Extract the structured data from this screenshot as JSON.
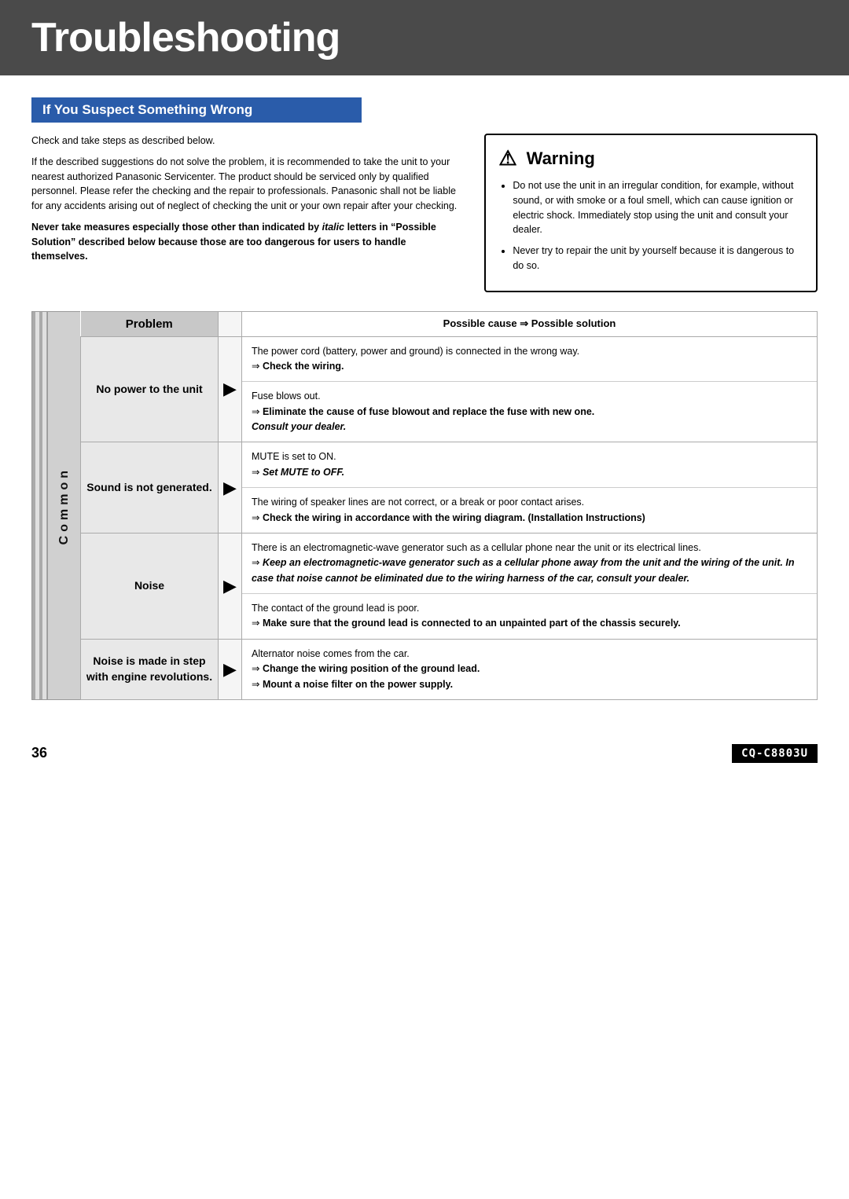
{
  "page": {
    "title": "Troubleshooting",
    "page_number": "36",
    "model": "CQ-C8803U"
  },
  "section": {
    "heading": "If You Suspect Something Wrong",
    "intro_p1": "Check and take steps as described below.",
    "intro_p2": "If the described suggestions do not solve the problem, it is recommended to take the unit to your nearest authorized Panasonic Servicenter. The product should be serviced only by qualified personnel. Please refer the checking and the repair to professionals. Panasonic shall not be liable for any accidents arising out of neglect of checking the unit or your own repair after your checking.",
    "intro_bold": "Never take measures especially those other than indicated by italic letters in “Possible Solution” described below because those are too dangerous for users to handle themselves."
  },
  "warning": {
    "title": "Warning",
    "bullet1": "Do not use the unit in an irregular condition, for example, without sound, or with smoke or a foul smell, which can cause ignition or electric shock. Immediately stop using the unit and consult your dealer.",
    "bullet2": "Never try to repair the unit by yourself because it is dangerous to do so."
  },
  "table": {
    "header_problem": "Problem",
    "header_solution": "Possible cause ⇒ Possible solution",
    "common_label": "Common",
    "rows": [
      {
        "problem": "No power to the unit",
        "solutions": [
          {
            "cause": "The power cord (battery, power and ground) is connected in the wrong way.",
            "solution": "Check the wiring.",
            "solution_bold": true
          },
          {
            "cause": "Fuse blows out.",
            "solution": "Eliminate the cause of fuse blowout and replace the fuse with new one. Consult your dealer.",
            "solution_bold": true,
            "solution_italic_part": "Consult your dealer."
          }
        ]
      },
      {
        "problem": "Sound is not generated.",
        "solutions": [
          {
            "cause": "MUTE is set to ON.",
            "solution": "Set MUTE to OFF.",
            "solution_bold": true,
            "solution_italic": true
          },
          {
            "cause": "The wiring of speaker lines are not correct, or a break or poor contact arises.",
            "solution": "Check the wiring in accordance with the wiring diagram. (Installation Instructions)",
            "solution_bold": true
          }
        ]
      },
      {
        "problem": "Noise",
        "solutions": [
          {
            "cause": "There is an electromagnetic-wave generator such as a cellular phone near the unit or its electrical lines.",
            "solution": "Keep an electromagnetic-wave generator such as a cellular phone away from the unit and the wiring of the unit. In case that noise cannot be eliminated due to the wiring harness of the car, consult your dealer.",
            "solution_bold": true,
            "solution_italic": true
          },
          {
            "cause": "The contact of the ground lead is poor.",
            "solution": "Make sure that the ground lead is connected to an unpainted part of the chassis securely.",
            "solution_bold": true
          }
        ]
      },
      {
        "problem": "Noise is made in step with engine revolutions.",
        "solutions": [
          {
            "cause": "Alternator noise comes from the car.",
            "solution1": "Change the wiring position of the ground lead.",
            "solution2": "Mount a noise filter on the power supply.",
            "solution_bold": true
          }
        ]
      }
    ]
  }
}
